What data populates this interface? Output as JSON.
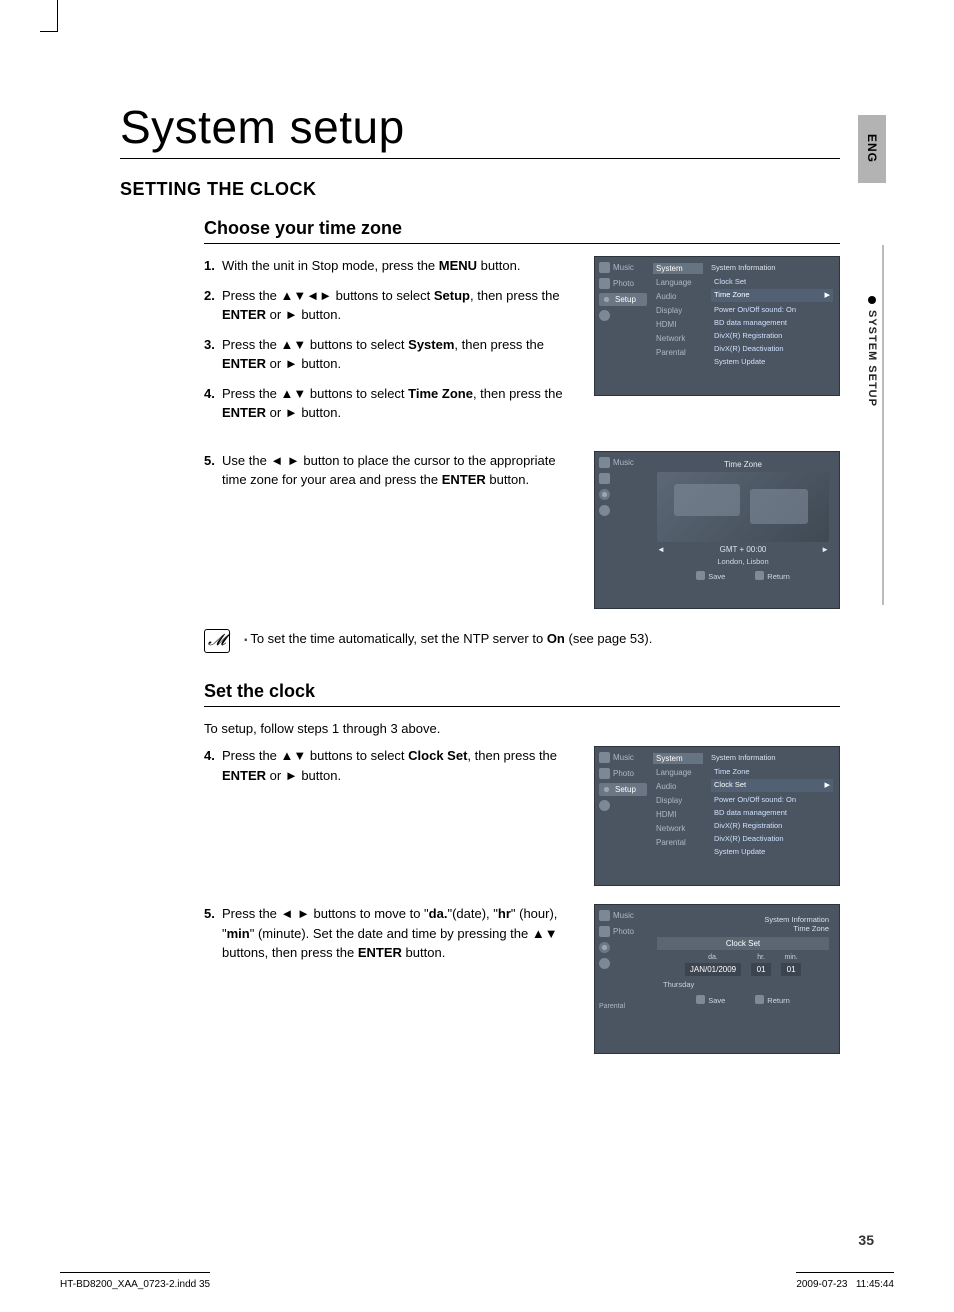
{
  "page": {
    "lang_tab": "ENG",
    "side_tab": "SYSTEM SETUP",
    "title": "System setup",
    "section": "SETTING THE CLOCK",
    "page_number": "35",
    "footer_file": "HT-BD8200_XAA_0723-2.indd   35",
    "footer_date": "2009-07-23",
    "footer_time": "11:45:44"
  },
  "choose_tz": {
    "heading": "Choose your time zone",
    "steps": [
      {
        "n": "1.",
        "pre": "With the unit in Stop mode, press the ",
        "b": "MENU",
        "post": " button."
      },
      {
        "n": "2.",
        "pre": "Press the ▲▼◄► buttons to select ",
        "b": "Setup",
        "post": ", then press the ",
        "b2": "ENTER",
        "post2": " or ► button."
      },
      {
        "n": "3.",
        "pre": "Press the ▲▼ buttons to select ",
        "b": "System",
        "post": ", then press the ",
        "b2": "ENTER",
        "post2": " or ► button."
      },
      {
        "n": "4.",
        "pre": "Press the ▲▼ buttons to select ",
        "b": "Time Zone",
        "post": ", then press the ",
        "b2": "ENTER",
        "post2": " or ► button."
      },
      {
        "n": "5.",
        "pre": "Use the ◄ ► button to place the cursor to the appropriate time zone for your area and press the ",
        "b": "ENTER",
        "post": " button."
      }
    ],
    "note": {
      "pre": "To set the time automatically, set the NTP server to ",
      "b": "On",
      "post": " (see page 53)."
    }
  },
  "set_clock": {
    "heading": "Set the clock",
    "intro": "To setup, follow steps 1 through 3 above.",
    "steps": [
      {
        "n": "4.",
        "pre": "Press the ▲▼ buttons to select ",
        "b": "Clock Set",
        "post": ", then press the ",
        "b2": "ENTER",
        "post2": " or ► button."
      },
      {
        "n": "5.",
        "pre": "Press the ◄ ► buttons to move to \"",
        "b": "da.",
        "mid": "\"(date), \"",
        "b2": "hr",
        "mid2": "\" (hour), \"",
        "b3": "min",
        "post": "\" (minute). Set the date and time by pressing the ▲▼ buttons, then press the ",
        "b4": "ENTER",
        "post2": " button."
      }
    ]
  },
  "shot_menu": {
    "sidebar": [
      "Music",
      "Photo",
      "Setup"
    ],
    "mid": [
      "System",
      "Language",
      "Audio",
      "Display",
      "HDMI",
      "Network",
      "Parental"
    ],
    "right_head": "System Information",
    "right": [
      {
        "l": "Clock Set"
      },
      {
        "l": "Time Zone",
        "sel": true
      },
      {
        "l": "Power On/Off sound",
        "v": ": On"
      },
      {
        "l": "BD data management"
      },
      {
        "l": "DivX(R) Registration"
      },
      {
        "l": "DivX(R) Deactivation"
      },
      {
        "l": "System Update"
      }
    ]
  },
  "shot_tz": {
    "title": "Time Zone",
    "gmt": "GMT + 00:00",
    "city": "London, Lisbon",
    "save": "Save",
    "ret": "Return"
  },
  "shot_menu2": {
    "right_head": "System Information",
    "right_sub": "Time Zone",
    "right": [
      {
        "l": "Clock Set",
        "sel": true
      },
      {
        "l": "Power On/Off sound",
        "v": ": On"
      },
      {
        "l": "BD data management"
      },
      {
        "l": "DivX(R) Registration"
      },
      {
        "l": "DivX(R) Deactivation"
      },
      {
        "l": "System Update"
      }
    ]
  },
  "shot_clock": {
    "head1": "System Information",
    "head2": "Time Zone",
    "bar": "Clock Set",
    "labels": {
      "da": "da.",
      "hr": "hr.",
      "min": "min."
    },
    "values": {
      "date": "JAN/01/2009",
      "hr": "01",
      "min": "01"
    },
    "day": "Thursday",
    "save": "Save",
    "ret": "Return",
    "parental": "Parental"
  }
}
